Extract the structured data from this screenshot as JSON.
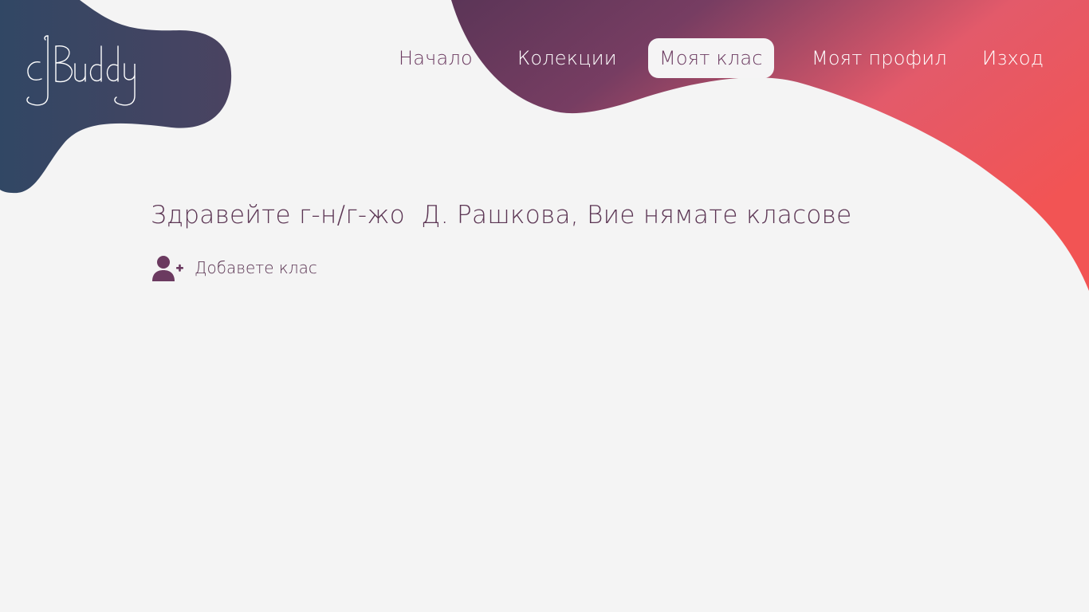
{
  "brand": {
    "logo_text": "cBuddy",
    "colors": {
      "background": "#f4f4f4",
      "blob_left_start": "#314764",
      "blob_left_end": "#4a4361",
      "blob_right_start": "#5b3557",
      "blob_right_end": "#f25454",
      "text_primary": "#5b3553"
    }
  },
  "nav": {
    "items": [
      {
        "label": "Начало",
        "active": false
      },
      {
        "label": "Колекции",
        "active": false
      },
      {
        "label": "Моят клас",
        "active": true
      },
      {
        "label": "Моят профил",
        "active": false
      },
      {
        "label": "Изход",
        "active": false
      }
    ]
  },
  "main": {
    "greeting": "Здравейте г-н/г-жо  Д. Рашкова, Вие нямате класове",
    "add_class": {
      "icon": "user-plus-icon",
      "label": "Добавете клас"
    }
  }
}
